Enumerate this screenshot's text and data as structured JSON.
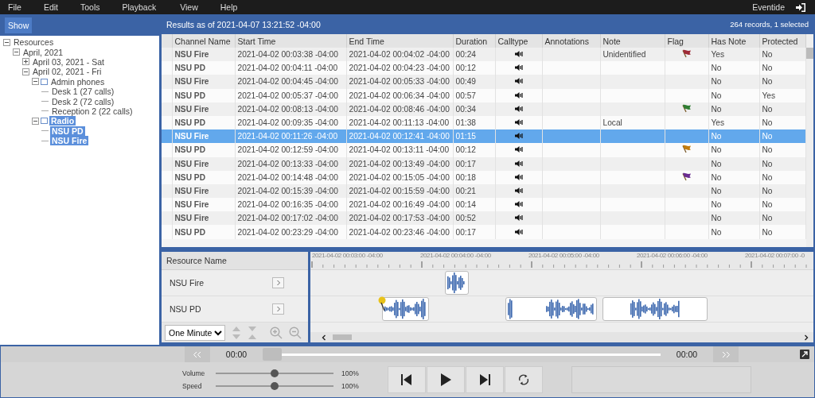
{
  "menu": [
    "File",
    "Edit",
    "Tools",
    "Playback",
    "View",
    "Help"
  ],
  "user": "Eventide",
  "left_panel": {
    "show_button": "Show",
    "tree": [
      {
        "label": "Resources",
        "expanded": true,
        "selected": false,
        "children": [
          {
            "label": "April, 2021",
            "expanded": true,
            "selected": false,
            "children": [
              {
                "label": "April 03, 2021 - Sat",
                "expanded": false,
                "selected": false
              },
              {
                "label": "April 02, 2021 - Fri",
                "expanded": true,
                "selected": false,
                "children": [
                  {
                    "label": "Admin phones",
                    "kind": "group",
                    "expanded": true,
                    "selected": false,
                    "children": [
                      {
                        "label": "Desk 1 (27 calls)",
                        "selected": false
                      },
                      {
                        "label": "Desk 2 (72 calls)",
                        "selected": false
                      },
                      {
                        "label": "Reception 2 (22 calls)",
                        "selected": false
                      }
                    ]
                  },
                  {
                    "label": "Radio",
                    "kind": "group",
                    "expanded": true,
                    "selected": true,
                    "children": [
                      {
                        "label": "NSU PD",
                        "selected": true
                      },
                      {
                        "label": "NSU Fire",
                        "selected": true
                      }
                    ]
                  }
                ]
              }
            ]
          }
        ]
      }
    ]
  },
  "results": {
    "title": "Results as of 2021-04-07 13:21:52 -04:00",
    "summary": "264 records, 1 selected"
  },
  "table": {
    "columns": [
      "Channel Name",
      "Start Time",
      "End Time",
      "Duration",
      "Calltype",
      "Annotations",
      "Note",
      "Flag",
      "Has Note",
      "Protected"
    ],
    "rows": [
      {
        "channel": "NSU Fire",
        "start": "2021-04-02 00:03:38 -04:00",
        "end": "2021-04-02 00:04:02 -04:00",
        "duration": "00:24",
        "note": "Unidentified",
        "color": "#9e2a36",
        "has_note": "Yes",
        "protected": "No",
        "selected": false
      },
      {
        "channel": "NSU PD",
        "start": "2021-04-02 00:04:11 -04:00",
        "end": "2021-04-02 00:04:23 -04:00",
        "duration": "00:12",
        "has_note": "No",
        "protected": "No",
        "selected": false
      },
      {
        "channel": "NSU Fire",
        "start": "2021-04-02 00:04:45 -04:00",
        "end": "2021-04-02 00:05:33 -04:00",
        "duration": "00:49",
        "has_note": "No",
        "protected": "No",
        "selected": false
      },
      {
        "channel": "NSU PD",
        "start": "2021-04-02 00:05:37 -04:00",
        "end": "2021-04-02 00:06:34 -04:00",
        "duration": "00:57",
        "has_note": "No",
        "protected": "Yes",
        "selected": false
      },
      {
        "channel": "NSU Fire",
        "start": "2021-04-02 00:08:13 -04:00",
        "end": "2021-04-02 00:08:46 -04:00",
        "duration": "00:34",
        "color": "#2e7d32",
        "has_note": "No",
        "protected": "No",
        "selected": false
      },
      {
        "channel": "NSU PD",
        "start": "2021-04-02 00:09:35 -04:00",
        "end": "2021-04-02 00:11:13 -04:00",
        "duration": "01:38",
        "note": "Local",
        "has_note": "Yes",
        "protected": "No",
        "selected": false
      },
      {
        "channel": "NSU Fire",
        "start": "2021-04-02 00:11:26 -04:00",
        "end": "2021-04-02 00:12:41 -04:00",
        "duration": "01:15",
        "has_note": "No",
        "protected": "No",
        "selected": true
      },
      {
        "channel": "NSU PD",
        "start": "2021-04-02 00:12:59 -04:00",
        "end": "2021-04-02 00:13:11 -04:00",
        "duration": "00:12",
        "color": "#c27c0e",
        "has_note": "No",
        "protected": "No",
        "selected": false
      },
      {
        "channel": "NSU Fire",
        "start": "2021-04-02 00:13:33 -04:00",
        "end": "2021-04-02 00:13:49 -04:00",
        "duration": "00:17",
        "has_note": "No",
        "protected": "No",
        "selected": false
      },
      {
        "channel": "NSU PD",
        "start": "2021-04-02 00:14:48 -04:00",
        "end": "2021-04-02 00:15:05 -04:00",
        "duration": "00:18",
        "color": "#6a2c91",
        "has_note": "No",
        "protected": "No",
        "selected": false
      },
      {
        "channel": "NSU Fire",
        "start": "2021-04-02 00:15:39 -04:00",
        "end": "2021-04-02 00:15:59 -04:00",
        "duration": "00:21",
        "has_note": "No",
        "protected": "No",
        "selected": false
      },
      {
        "channel": "NSU Fire",
        "start": "2021-04-02 00:16:35 -04:00",
        "end": "2021-04-02 00:16:49 -04:00",
        "duration": "00:14",
        "has_note": "No",
        "protected": "No",
        "selected": false
      },
      {
        "channel": "NSU Fire",
        "start": "2021-04-02 00:17:02 -04:00",
        "end": "2021-04-02 00:17:53 -04:00",
        "duration": "00:52",
        "has_note": "No",
        "protected": "No",
        "selected": false
      },
      {
        "channel": "NSU PD",
        "start": "2021-04-02 00:23:29 -04:00",
        "end": "2021-04-02 00:23:46 -04:00",
        "duration": "00:17",
        "has_note": "No",
        "protected": "No",
        "selected": false
      }
    ]
  },
  "timeline": {
    "header": "Resource Name",
    "resources": [
      "NSU Fire",
      "NSU PD"
    ],
    "zoom": "One Minute",
    "ticks": [
      "2021-04-02 00:03:00 -04:00",
      "2021-04-02 00:04:00 -04:00",
      "2021-04-02 00:05:00 -04:00",
      "2021-04-02 00:06:00 -04:00",
      "2021-04-02 00:07:00 -0"
    ]
  },
  "player": {
    "position": "00:00",
    "length": "00:00",
    "progress": {
      "level": 0
    },
    "volume": {
      "label": "Volume",
      "level": 0.5,
      "reading": "100%"
    },
    "speed": {
      "label": "Speed",
      "level": 0.5,
      "reading": "100%"
    }
  }
}
